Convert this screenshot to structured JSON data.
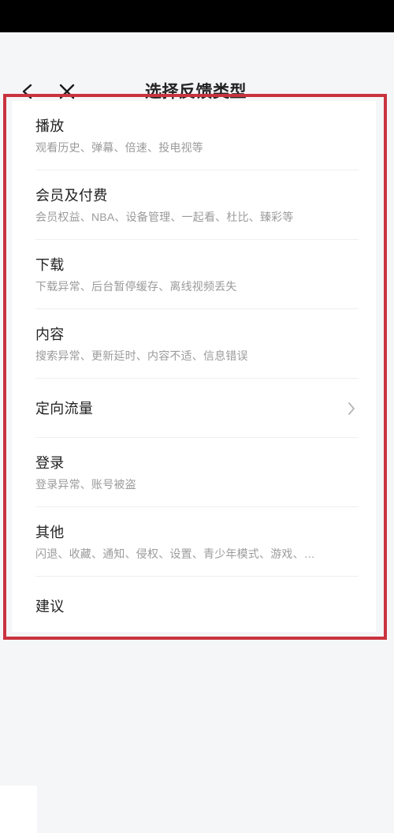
{
  "window": {
    "background_color": "#f5f6f8",
    "status_bar_color": "#000000"
  },
  "header": {
    "title": "选择反馈类型",
    "back_icon": "chevron-left-icon",
    "close_icon": "close-icon"
  },
  "highlight": {
    "color": "#c9333f",
    "label": "feedback-type-list-highlight"
  },
  "list": {
    "items": [
      {
        "title": "播放",
        "subtitle": "观看历史、弹幕、倍速、投电视等",
        "chevron": false
      },
      {
        "title": "会员及付费",
        "subtitle": "会员权益、NBA、设备管理、一起看、杜比、臻彩等",
        "chevron": false
      },
      {
        "title": "下载",
        "subtitle": "下载异常、后台暂停缓存、离线视频丢失",
        "chevron": false
      },
      {
        "title": "内容",
        "subtitle": "搜索异常、更新延时、内容不适、信息错误",
        "chevron": false
      },
      {
        "title": "定向流量",
        "subtitle": "",
        "chevron": true
      },
      {
        "title": "登录",
        "subtitle": "登录异常、账号被盗",
        "chevron": false
      },
      {
        "title": "其他",
        "subtitle": "闪退、收藏、通知、侵权、设置、青少年模式、游戏、…",
        "chevron": false
      },
      {
        "title": "建议",
        "subtitle": "",
        "chevron": false
      }
    ]
  }
}
